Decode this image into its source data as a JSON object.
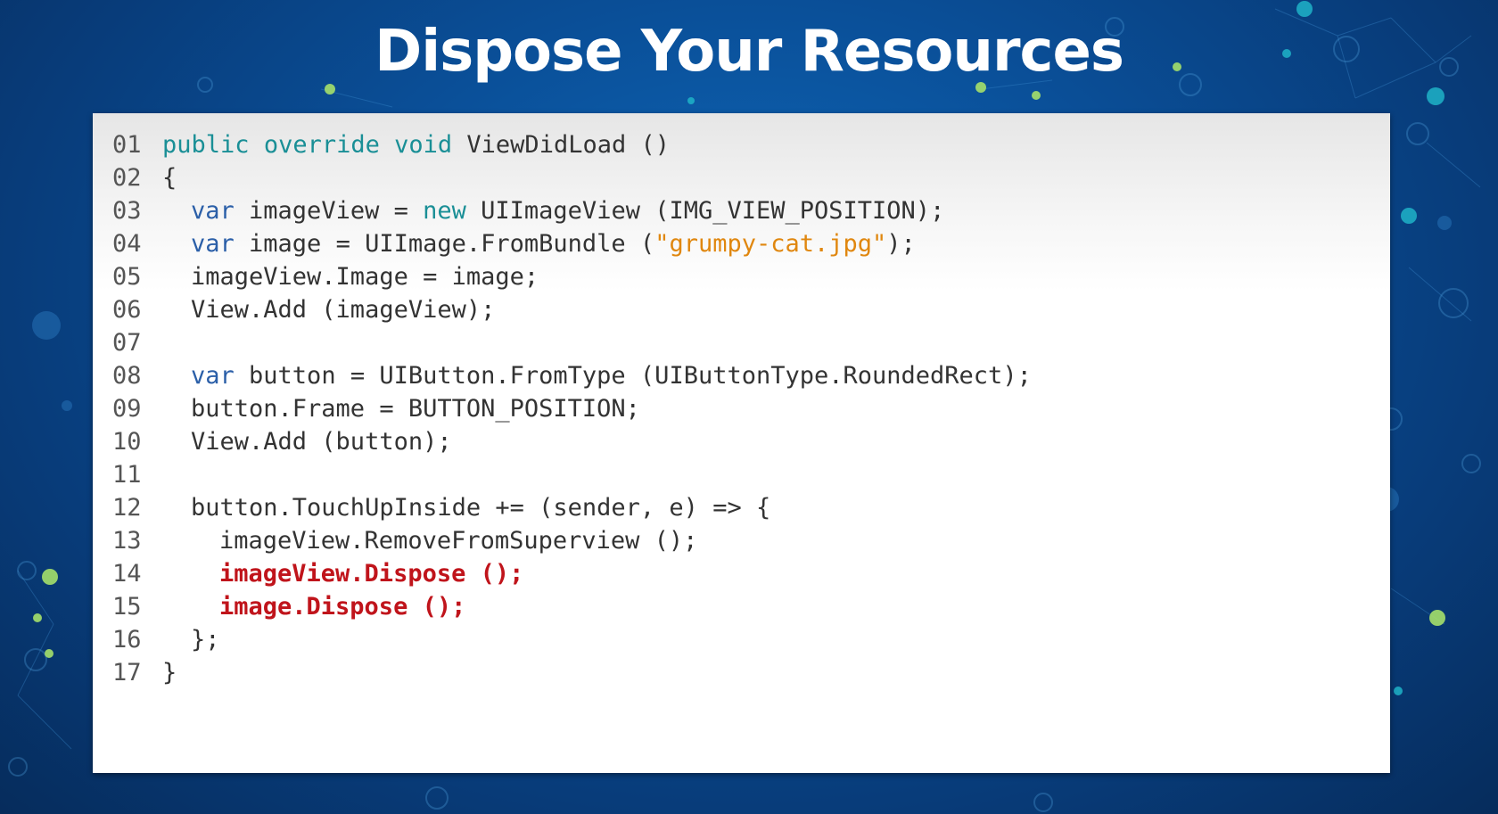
{
  "slide": {
    "title": "Dispose Your Resources"
  },
  "colors": {
    "background": "#0a4f98",
    "keyword_teal": "#1a8f96",
    "keyword_blue": "#2b5fa8",
    "string_orange": "#e0870f",
    "highlight_red": "#c0141b"
  },
  "code": {
    "lines": [
      {
        "num": "01",
        "parts": [
          "public",
          " ",
          "override",
          " ",
          "void",
          " ViewDidLoad ()"
        ]
      },
      {
        "num": "02",
        "parts": [
          "{"
        ]
      },
      {
        "num": "03",
        "parts": [
          "var",
          " imageView = ",
          "new",
          " UIImageView (IMG_VIEW_POSITION);"
        ]
      },
      {
        "num": "04",
        "parts": [
          "var",
          " image = UIImage.FromBundle (",
          "\"grumpy-cat.jpg\"",
          ");"
        ]
      },
      {
        "num": "05",
        "parts": [
          "imageView.Image = image;"
        ]
      },
      {
        "num": "06",
        "parts": [
          "View.Add (imageView);"
        ]
      },
      {
        "num": "07",
        "parts": [
          ""
        ]
      },
      {
        "num": "08",
        "parts": [
          "var",
          " button = UIButton.FromType (UIButtonType.RoundedRect);"
        ]
      },
      {
        "num": "09",
        "parts": [
          "button.Frame = BUTTON_POSITION;"
        ]
      },
      {
        "num": "10",
        "parts": [
          "View.Add (button);"
        ]
      },
      {
        "num": "11",
        "parts": [
          ""
        ]
      },
      {
        "num": "12",
        "parts": [
          "button.TouchUpInside += (sender, e) => {"
        ]
      },
      {
        "num": "13",
        "parts": [
          "imageView.RemoveFromSuperview ();"
        ]
      },
      {
        "num": "14",
        "parts": [
          "imageView.Dispose ();"
        ]
      },
      {
        "num": "15",
        "parts": [
          "image.Dispose ();"
        ]
      },
      {
        "num": "16",
        "parts": [
          "};"
        ]
      },
      {
        "num": "17",
        "parts": [
          "}"
        ]
      }
    ]
  }
}
